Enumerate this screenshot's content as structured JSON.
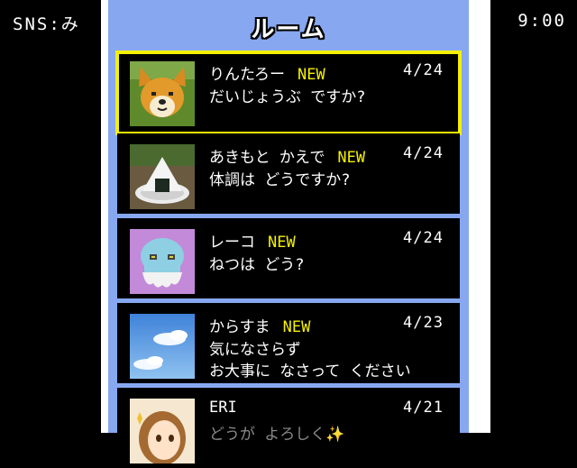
{
  "header": {
    "sns_label": "SNS:み",
    "clock": "9:00"
  },
  "title": "ルーム",
  "rooms": [
    {
      "name": "りんたろー",
      "new": "NEW",
      "date": "4/24",
      "lines": [
        "だいじょうぶ ですか?"
      ],
      "avatar": "dog-avatar"
    },
    {
      "name": "あきもと かえで",
      "new": "NEW",
      "date": "4/24",
      "lines": [
        "体調は どうですか?"
      ],
      "avatar": "onigiri-avatar"
    },
    {
      "name": "レーコ",
      "new": "NEW",
      "date": "4/24",
      "lines": [
        "ねつは どう?"
      ],
      "avatar": "ghost-avatar"
    },
    {
      "name": "からすま",
      "new": "NEW",
      "date": "4/23",
      "lines": [
        "気になさらず",
        "お大事に なさって ください"
      ],
      "avatar": "sky-avatar"
    },
    {
      "name": "ERI",
      "new": "",
      "date": "4/21",
      "lines": [
        "どうが よろしく✨"
      ],
      "avatar": "girl-avatar"
    }
  ],
  "colors": {
    "accent": "#f4f000",
    "panel": "#87a8f0",
    "row": "#000000"
  }
}
